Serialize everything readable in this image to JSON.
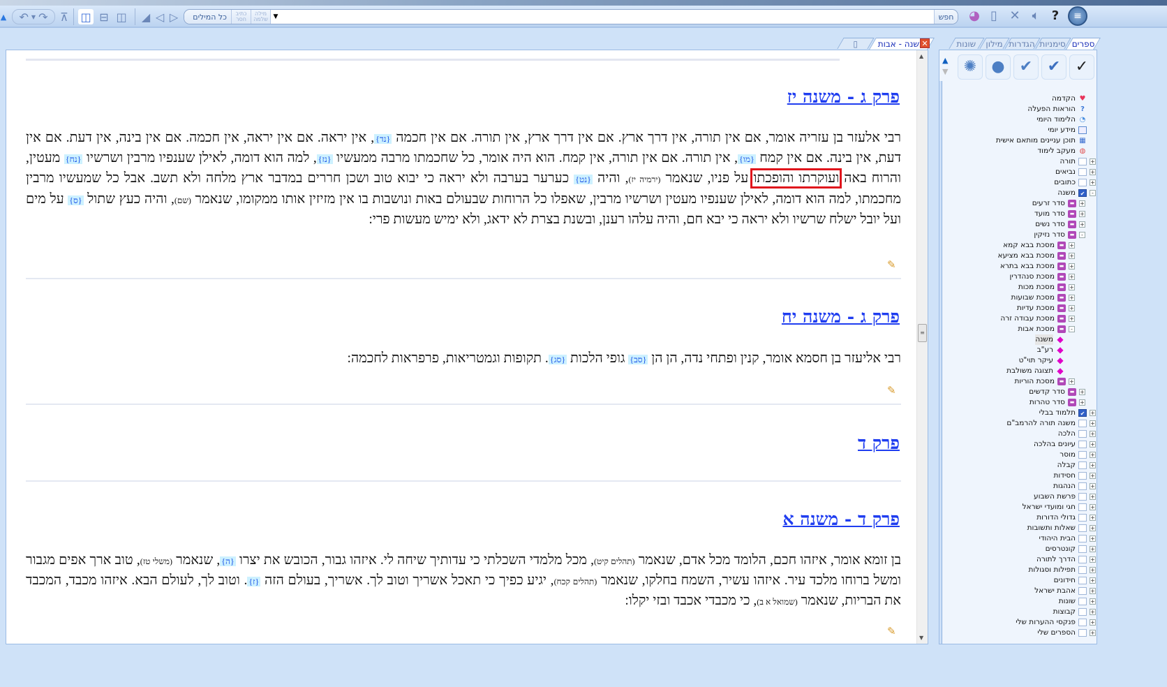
{
  "toolbar": {
    "search_mode_all": "כל המילים",
    "search_mode_partial": "כתיב חסר",
    "search_mode_whole": "מילה שלמה",
    "search_value": "",
    "search_button": "חפש"
  },
  "doc_tab": {
    "title": "משנה - אבות"
  },
  "panel_tabs": [
    "ספרים",
    "סימניות",
    "הגדרות",
    "מילון",
    "שונות"
  ],
  "sections": [
    {
      "heading": "פרק ג - משנה יז",
      "paragraph": [
        {
          "t": "רבי אלעזר בן עזריה אומר, אם אין תורה, אין דרך ארץ. אם אין דרך ארץ, אין תורה. אם אין חכמה "
        },
        {
          "m": "{נד}"
        },
        {
          "t": ", אין יראה. אם אין יראה, אין חכמה. אם אין בינה, אין דעת. אם אין דעת, אין בינה. אם אין קמח "
        },
        {
          "m": "{מו}"
        },
        {
          "t": ", אין תורה. אם אין תורה, אין קמח. הוא היה אומר, כל שחכמתו מרבה ממעשיו "
        },
        {
          "m": "{נז}"
        },
        {
          "t": ", למה הוא דומה, לאילן שענפיו מרבין ושרשיו "
        },
        {
          "m": "{נח}"
        },
        {
          "t": " מעטין, והרוח באה "
        },
        {
          "h": "ועוקרתו והופכתו"
        },
        {
          "t": " על פניו, שנאמר "
        },
        {
          "r": "(ירמיה יז)"
        },
        {
          "t": ", והיה "
        },
        {
          "m": "{נט}"
        },
        {
          "t": " כערער בערבה ולא יראה כי יבוא טוב ושכן חררים במדבר ארץ מלחה ולא תשב. אבל כל שמעשיו מרבין מחכמתו, למה הוא דומה, לאילן שענפיו מעטין ושרשיו מרבין, שאפלו כל הרוחות שבעולם באות ונושבות בו אין מזיזין אותו ממקומו, שנאמר "
        },
        {
          "r": "(שם)"
        },
        {
          "t": ", והיה כעץ שתול "
        },
        {
          "m": "{ס}"
        },
        {
          "t": " על מים ועל יובל ישלח שרשיו ולא יראה כי יבא חם, והיה עלהו רענן, ובשנת בצרת לא ידאג, ולא ימיש מעשות פרי:"
        }
      ]
    },
    {
      "heading": "פרק ג - משנה יח",
      "paragraph": [
        {
          "t": "רבי אליעזר בן חסמא אומר, קנין ופתחי נדה, הן הן "
        },
        {
          "m": "{סב}"
        },
        {
          "t": " גופי הלכות "
        },
        {
          "m": "{סג}"
        },
        {
          "t": ". תקופות וגמטריאות, פרפראות לחכמה:"
        }
      ]
    },
    {
      "heading": "פרק ד",
      "paragraph": []
    },
    {
      "heading": "פרק ד - משנה א",
      "paragraph": [
        {
          "t": "בן זומא אומר, איזהו חכם, הלומד מכל אדם, שנאמר "
        },
        {
          "r": "(תהלים קיט)"
        },
        {
          "t": ", מכל מלמדי השכלתי כי עדותיך שיחה לי. איזהו גבור, הכובש את יצרו "
        },
        {
          "m": "{ה}"
        },
        {
          "t": ", שנאמר "
        },
        {
          "r": "(משלי טז)"
        },
        {
          "t": ", טוב ארך אפים מגבור ומשל ברוחו מלכד עיר. איזהו עשיר, השמח בחלקו, שנאמר "
        },
        {
          "r": "(תהלים קכח)"
        },
        {
          "t": ", יגיע כפיך כי תאכל אשריך וטוב לך. אשריך, בעולם הזה "
        },
        {
          "m": "{ז}"
        },
        {
          "t": ". וטוב לך, לעולם הבא. איזהו מכבד, המכבד את הבריות, שנאמר "
        },
        {
          "r": "(שמואל א ב)"
        },
        {
          "t": ", כי מכבדי אכבד ובזי יקלו:"
        }
      ]
    }
  ],
  "tree": [
    {
      "label": "הקדמה",
      "level": 0,
      "icon": "heart",
      "exp": ""
    },
    {
      "label": "הוראות הפעלה",
      "level": 0,
      "icon": "help",
      "exp": ""
    },
    {
      "label": "הלימוד היומי",
      "level": 0,
      "icon": "dot",
      "exp": ""
    },
    {
      "label": "מידע יומי",
      "level": 0,
      "icon": "cal",
      "exp": ""
    },
    {
      "label": "תוכן עניינים מותאם אישית",
      "level": 0,
      "icon": "grid",
      "exp": ""
    },
    {
      "label": "מעקב לימוד",
      "level": 0,
      "icon": "red",
      "exp": ""
    },
    {
      "label": "תורה",
      "level": 0,
      "icon": "box",
      "exp": "+"
    },
    {
      "label": "נביאים",
      "level": 0,
      "icon": "box",
      "exp": "+"
    },
    {
      "label": "כתובים",
      "level": 0,
      "icon": "box",
      "exp": "+"
    },
    {
      "label": "משנה",
      "level": 0,
      "icon": "checked",
      "exp": "-"
    },
    {
      "label": "סדר זרעים",
      "level": 1,
      "icon": "book",
      "exp": "+"
    },
    {
      "label": "סדר מועד",
      "level": 1,
      "icon": "book",
      "exp": "+"
    },
    {
      "label": "סדר נשים",
      "level": 1,
      "icon": "book",
      "exp": "+"
    },
    {
      "label": "סדר נזיקין",
      "level": 1,
      "icon": "book",
      "exp": "-"
    },
    {
      "label": "מסכת בבא קמא",
      "level": 2,
      "icon": "book",
      "exp": "+"
    },
    {
      "label": "מסכת בבא מציעא",
      "level": 2,
      "icon": "book",
      "exp": "+"
    },
    {
      "label": "מסכת בבא בתרא",
      "level": 2,
      "icon": "book",
      "exp": "+"
    },
    {
      "label": "מסכת סנהדרין",
      "level": 2,
      "icon": "book",
      "exp": "+"
    },
    {
      "label": "מסכת מכות",
      "level": 2,
      "icon": "book",
      "exp": "+"
    },
    {
      "label": "מסכת שבועות",
      "level": 2,
      "icon": "book",
      "exp": "+"
    },
    {
      "label": "מסכת עדיות",
      "level": 2,
      "icon": "book",
      "exp": "+"
    },
    {
      "label": "מסכת עבודה זרה",
      "level": 2,
      "icon": "book",
      "exp": "+"
    },
    {
      "label": "מסכת אבות",
      "level": 2,
      "icon": "book",
      "exp": "-"
    },
    {
      "label": "משנה",
      "level": 3,
      "icon": "diamond",
      "exp": "",
      "selected": true
    },
    {
      "label": "רע\"ב",
      "level": 3,
      "icon": "diamond",
      "exp": ""
    },
    {
      "label": "עיקר תוי\"ט",
      "level": 3,
      "icon": "diamond",
      "exp": ""
    },
    {
      "label": "תצוגה משולבת",
      "level": 3,
      "icon": "diamond",
      "exp": ""
    },
    {
      "label": "מסכת הוריות",
      "level": 2,
      "icon": "book",
      "exp": "+"
    },
    {
      "label": "סדר קדשים",
      "level": 1,
      "icon": "book",
      "exp": "+"
    },
    {
      "label": "סדר טהרות",
      "level": 1,
      "icon": "book",
      "exp": "+"
    },
    {
      "label": "תלמוד בבלי",
      "level": 0,
      "icon": "checked",
      "exp": "+"
    },
    {
      "label": "משנה תורה להרמב\"ם",
      "level": 0,
      "icon": "box",
      "exp": "+"
    },
    {
      "label": "הלכה",
      "level": 0,
      "icon": "box",
      "exp": "+"
    },
    {
      "label": "עיונים בהלכה",
      "level": 0,
      "icon": "box",
      "exp": "+"
    },
    {
      "label": "מוסר",
      "level": 0,
      "icon": "box",
      "exp": "+"
    },
    {
      "label": "קבלה",
      "level": 0,
      "icon": "box",
      "exp": "+"
    },
    {
      "label": "חסידות",
      "level": 0,
      "icon": "box",
      "exp": "+"
    },
    {
      "label": "הנהגות",
      "level": 0,
      "icon": "box",
      "exp": "+"
    },
    {
      "label": "פרשת השבוע",
      "level": 0,
      "icon": "box",
      "exp": "+"
    },
    {
      "label": "חגי ומועדי ישראל",
      "level": 0,
      "icon": "box",
      "exp": "+"
    },
    {
      "label": "גדולי הדורות",
      "level": 0,
      "icon": "box",
      "exp": "+"
    },
    {
      "label": "שאלות ותשובות",
      "level": 0,
      "icon": "box",
      "exp": "+"
    },
    {
      "label": "הבית היהודי",
      "level": 0,
      "icon": "box",
      "exp": "+"
    },
    {
      "label": "קונטרסים",
      "level": 0,
      "icon": "box",
      "exp": "+"
    },
    {
      "label": "הדרך לתורה",
      "level": 0,
      "icon": "box",
      "exp": "+"
    },
    {
      "label": "תפילות וסגולות",
      "level": 0,
      "icon": "box",
      "exp": "+"
    },
    {
      "label": "חידונים",
      "level": 0,
      "icon": "box",
      "exp": "+"
    },
    {
      "label": "אהבת ישראל",
      "level": 0,
      "icon": "box",
      "exp": "+"
    },
    {
      "label": "שונות",
      "level": 0,
      "icon": "box",
      "exp": "+"
    },
    {
      "label": "קבוצות",
      "level": 0,
      "icon": "box",
      "exp": "+"
    },
    {
      "label": "פנקסי ההערות שלי",
      "level": 0,
      "icon": "box",
      "exp": "+"
    },
    {
      "label": "הספרים שלי",
      "level": 0,
      "icon": "box",
      "exp": "+"
    }
  ]
}
